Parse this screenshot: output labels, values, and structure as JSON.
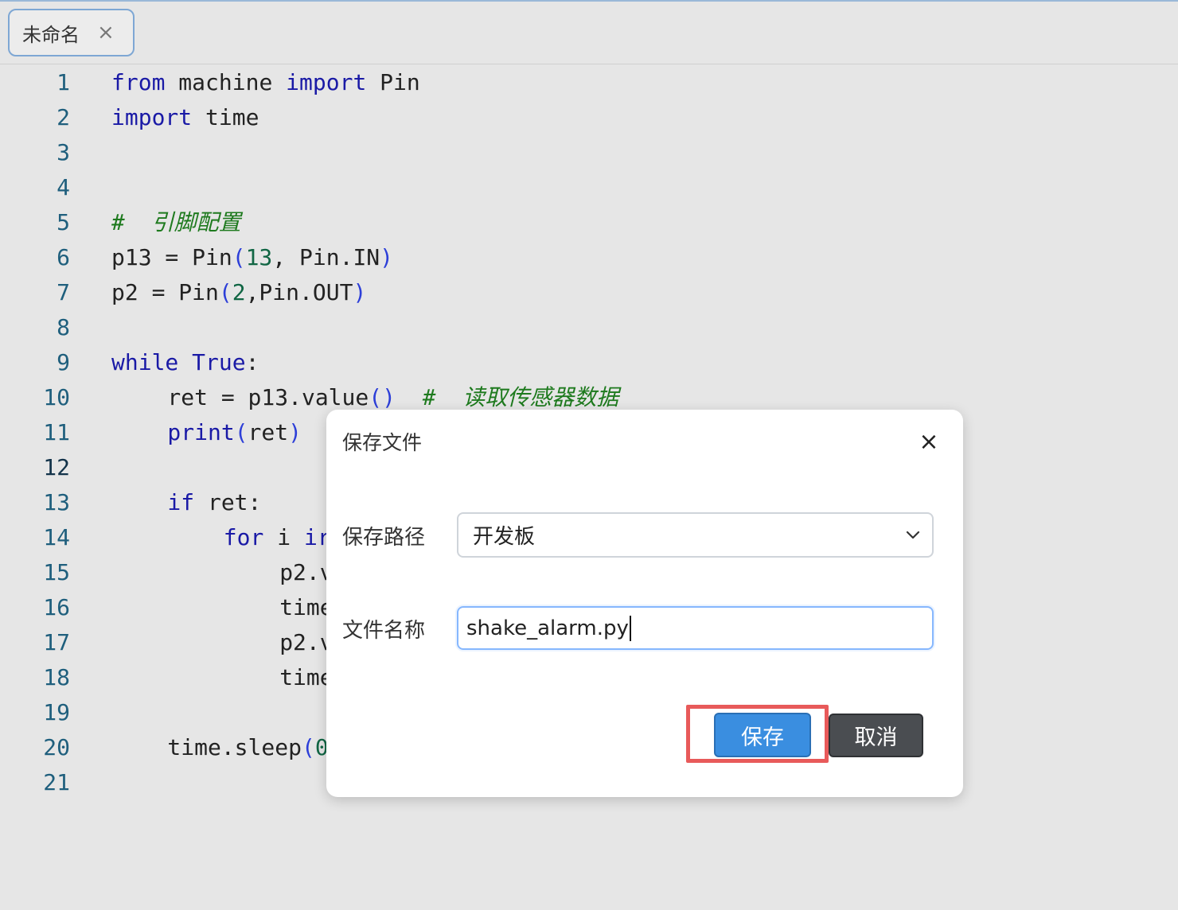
{
  "tab": {
    "label": "未命名",
    "close_glyph": "×"
  },
  "editor": {
    "active_line": 12,
    "lines": [
      {
        "n": "1",
        "indent": 0,
        "tokens": [
          {
            "t": "from",
            "c": "kw"
          },
          {
            "t": " machine "
          },
          {
            "t": "import",
            "c": "kw"
          },
          {
            "t": " Pin"
          }
        ]
      },
      {
        "n": "2",
        "indent": 0,
        "tokens": [
          {
            "t": "import",
            "c": "kw"
          },
          {
            "t": " time"
          }
        ]
      },
      {
        "n": "3",
        "indent": 0,
        "tokens": []
      },
      {
        "n": "4",
        "indent": 0,
        "tokens": []
      },
      {
        "n": "5",
        "indent": 0,
        "tokens": [
          {
            "t": "#  引脚配置",
            "c": "comment"
          }
        ]
      },
      {
        "n": "6",
        "indent": 0,
        "tokens": [
          {
            "t": "p13 = Pin"
          },
          {
            "t": "(",
            "c": "paren"
          },
          {
            "t": "13",
            "c": "num"
          },
          {
            "t": ", Pin.IN"
          },
          {
            "t": ")",
            "c": "paren"
          }
        ]
      },
      {
        "n": "7",
        "indent": 0,
        "tokens": [
          {
            "t": "p2 = Pin"
          },
          {
            "t": "(",
            "c": "paren"
          },
          {
            "t": "2",
            "c": "num"
          },
          {
            "t": ",Pin.OUT"
          },
          {
            "t": ")",
            "c": "paren"
          }
        ]
      },
      {
        "n": "8",
        "indent": 0,
        "tokens": []
      },
      {
        "n": "9",
        "indent": 0,
        "tokens": [
          {
            "t": "while",
            "c": "kw"
          },
          {
            "t": " "
          },
          {
            "t": "True",
            "c": "kw"
          },
          {
            "t": ":"
          }
        ]
      },
      {
        "n": "10",
        "indent": 4,
        "tokens": [
          {
            "t": "ret = p13.value"
          },
          {
            "t": "()",
            "c": "paren"
          },
          {
            "t": "  "
          },
          {
            "t": "#  读取传感器数据",
            "c": "comment"
          }
        ]
      },
      {
        "n": "11",
        "indent": 4,
        "tokens": [
          {
            "t": "print",
            "c": "kw"
          },
          {
            "t": "(",
            "c": "paren"
          },
          {
            "t": "ret"
          },
          {
            "t": ")",
            "c": "paren"
          }
        ]
      },
      {
        "n": "12",
        "indent": 0,
        "tokens": []
      },
      {
        "n": "13",
        "indent": 4,
        "tokens": [
          {
            "t": "if",
            "c": "kw"
          },
          {
            "t": " ret:"
          }
        ]
      },
      {
        "n": "14",
        "indent": 8,
        "tokens": [
          {
            "t": "for",
            "c": "kw"
          },
          {
            "t": " i "
          },
          {
            "t": "ir",
            "c": "kw"
          }
        ]
      },
      {
        "n": "15",
        "indent": 12,
        "tokens": [
          {
            "t": "p2.v"
          }
        ]
      },
      {
        "n": "16",
        "indent": 12,
        "tokens": [
          {
            "t": "time"
          }
        ]
      },
      {
        "n": "17",
        "indent": 12,
        "tokens": [
          {
            "t": "p2.v"
          }
        ]
      },
      {
        "n": "18",
        "indent": 12,
        "tokens": [
          {
            "t": "time"
          }
        ]
      },
      {
        "n": "19",
        "indent": 0,
        "tokens": []
      },
      {
        "n": "20",
        "indent": 4,
        "tokens": [
          {
            "t": "time.sleep"
          },
          {
            "t": "(",
            "c": "paren"
          },
          {
            "t": "0",
            "c": "num"
          }
        ]
      },
      {
        "n": "21",
        "indent": 0,
        "tokens": []
      }
    ]
  },
  "dialog": {
    "title": "保存文件",
    "close_glyph": "×",
    "path_label": "保存路径",
    "path_value": "开发板",
    "name_label": "文件名称",
    "name_value": "shake_alarm.py",
    "save_label": "保存",
    "cancel_label": "取消"
  },
  "colors": {
    "highlight_border": "#e85a5a",
    "save_button": "#3a8ee0",
    "cancel_button": "#4a4d51",
    "input_focus_border": "#86b7fe"
  }
}
